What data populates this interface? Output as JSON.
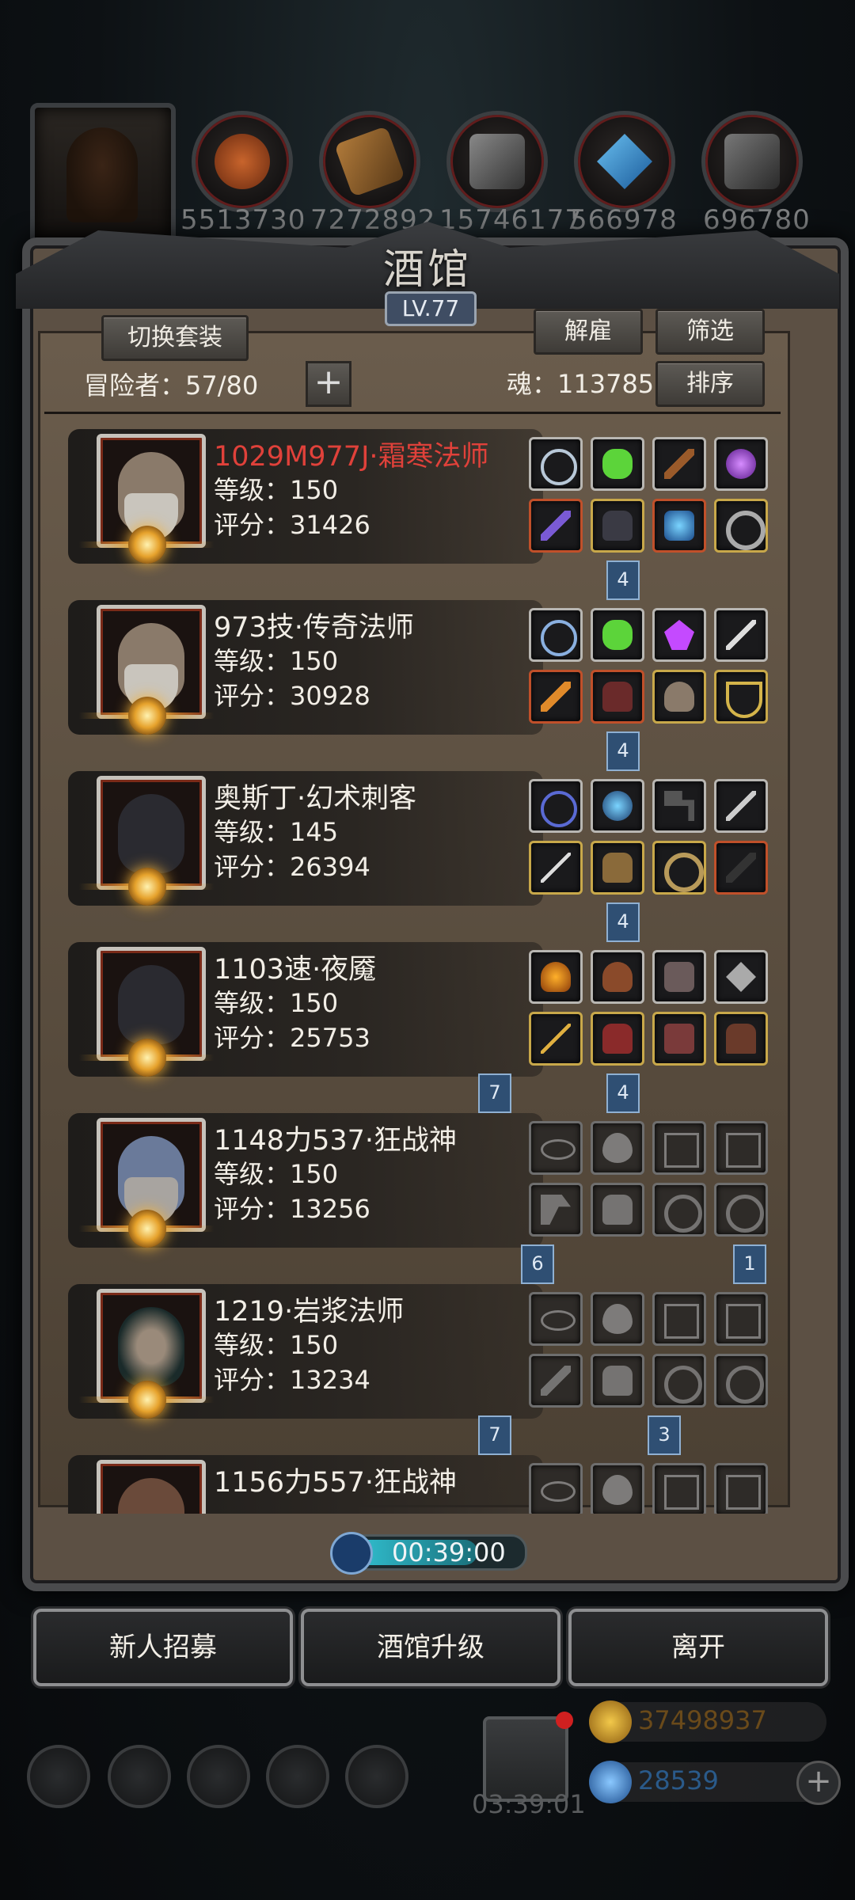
{
  "resources": [
    "5513730",
    "7272892",
    "15746177",
    "566978",
    "696780"
  ],
  "title": "酒馆",
  "level_badge": "LV.77",
  "buttons": {
    "switch_set": "切换套装",
    "dismiss": "解雇",
    "filter": "筛选",
    "sort": "排序"
  },
  "adventurers_label": "冒险者：57/80",
  "soul_label": "魂：113785",
  "heroes": [
    {
      "name": "1029M977J·霜寒法师",
      "level": "等级：150",
      "score": "评分：31426",
      "highlight": true
    },
    {
      "name": "973技·传奇法师",
      "level": "等级：150",
      "score": "评分：30928",
      "highlight": false
    },
    {
      "name": "奥斯丁·幻术刺客",
      "level": "等级：145",
      "score": "评分：26394",
      "highlight": false
    },
    {
      "name": "1103速·夜魇",
      "level": "等级：150",
      "score": "评分：25753",
      "highlight": false
    },
    {
      "name": "1148力537·狂战神",
      "level": "等级：150",
      "score": "评分：13256",
      "highlight": false
    },
    {
      "name": "1219·岩浆法师",
      "level": "等级：150",
      "score": "评分：13234",
      "highlight": false
    },
    {
      "name": "1156力557·狂战神",
      "level": "",
      "score": "",
      "highlight": false
    }
  ],
  "badges": [
    "4",
    "4",
    "4",
    "7",
    "4",
    "6",
    "1",
    "7",
    "3"
  ],
  "timer": "00:39:00",
  "bottom_buttons": {
    "recruit": "新人招募",
    "upgrade": "酒馆升级",
    "leave": "离开"
  },
  "gift_timer": "03:39:01",
  "gold": "37498937",
  "gems": "28539",
  "icons": [
    "settings-icon",
    "emblem-icon",
    "helmet-icon",
    "mail-icon",
    "cube-icon"
  ]
}
